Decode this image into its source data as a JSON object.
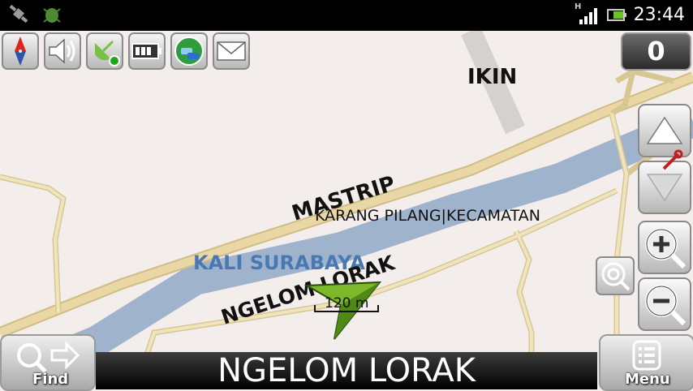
{
  "status_bar": {
    "time": "23:44",
    "network_type": "H",
    "icons": [
      "gps-satellite-icon",
      "bug-icon",
      "signal-strength-icon",
      "battery-icon"
    ]
  },
  "toolbar": {
    "icons": [
      "compass-icon",
      "speaker-icon",
      "gps-status-icon",
      "battery-level-icon",
      "traffic-icon",
      "message-icon"
    ]
  },
  "counter": {
    "value": "0"
  },
  "map": {
    "labels": {
      "ikin": "IKIN",
      "mastrip": "MASTRIP",
      "karang_pilang": "KARANG PILANG|KECAMATAN",
      "kali_surabaya": "KALI SURABAYA",
      "ngelom_lorak": "NGELOM LORAK"
    },
    "scale": "120 m",
    "colors": {
      "background": "#f3eeec",
      "road": "#e9d8a5",
      "road_border": "#d0bd84",
      "river": "#9fb4cc",
      "river_label": "#4a79b2",
      "arrow": "#7cb829"
    }
  },
  "right_controls": [
    "zoom-up-icon",
    "zoom-down-icon",
    "zoom-in-icon",
    "zoom-out-icon",
    "tools-icon",
    "search-around-icon"
  ],
  "bottom": {
    "current_street": "NGELOM LORAK",
    "find_label": "Find",
    "menu_label": "Menu"
  }
}
